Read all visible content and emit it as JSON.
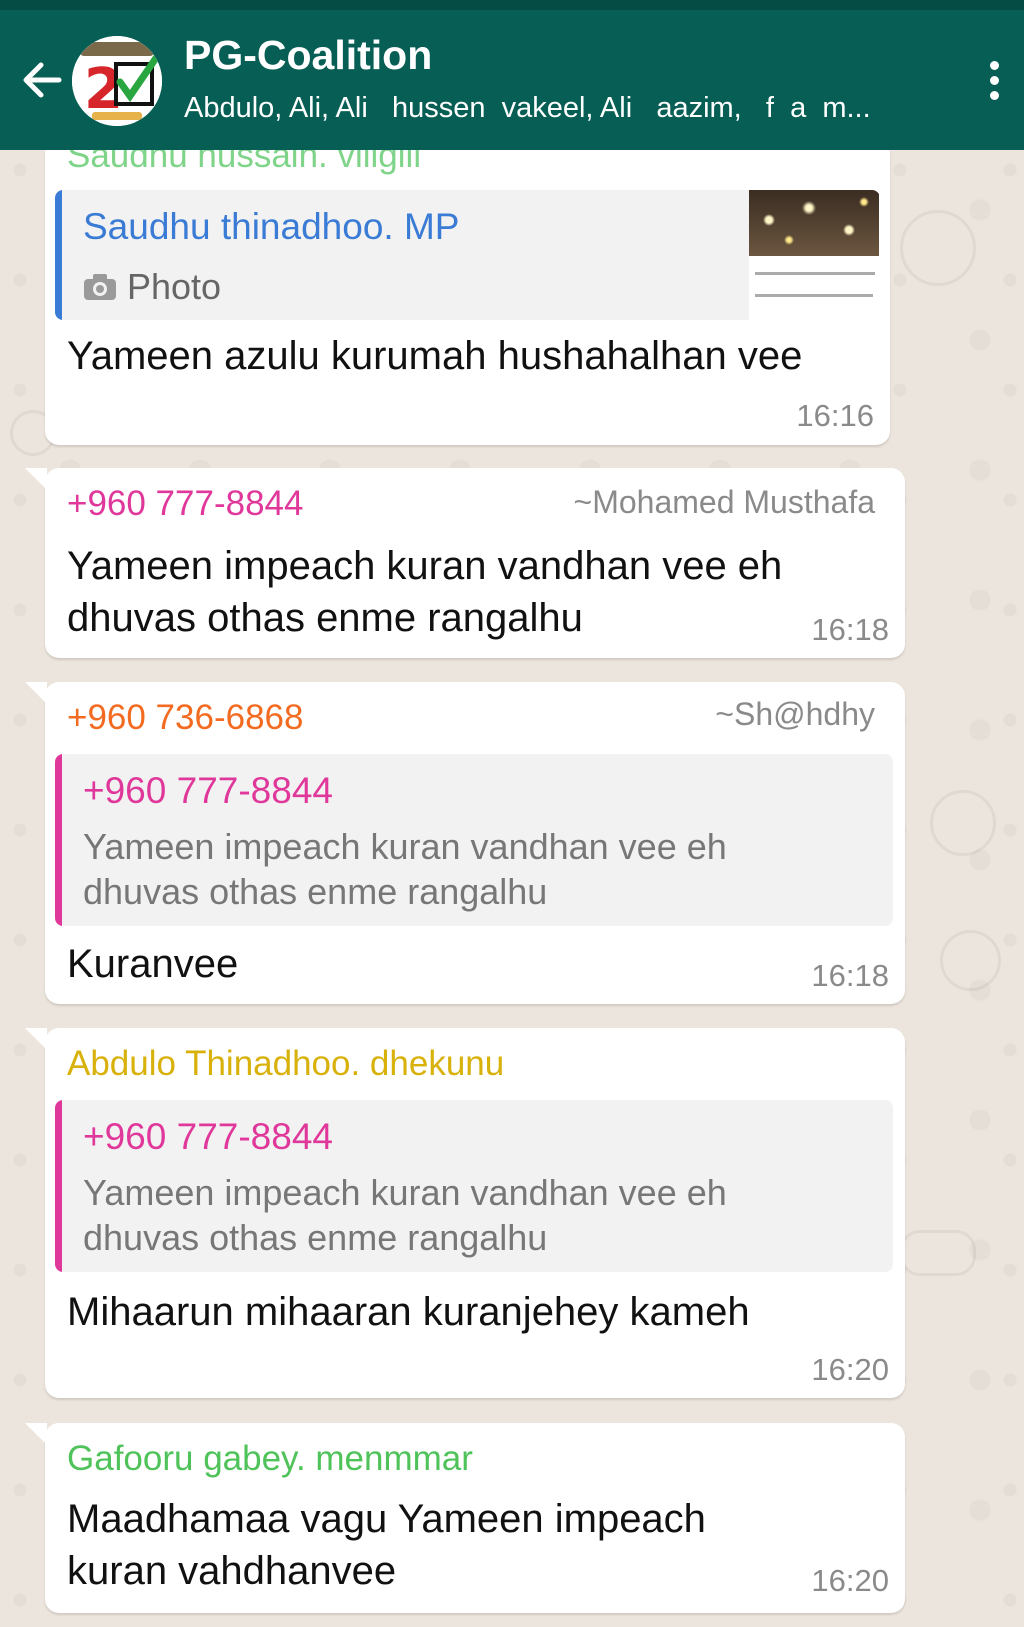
{
  "header": {
    "title": "PG-Coalition",
    "members": "Abdulo, Ali, Ali   hussen  vakeel, Ali   aazim,   f  a  m..."
  },
  "top_partial": {
    "sender": "Saudhu hussain. viligili"
  },
  "messages": [
    {
      "quote_sender": "Saudhu thinadhoo. MP",
      "quote_type": "Photo",
      "text": "Yameen azulu kurumah hushahalhan vee",
      "time": "16:16"
    },
    {
      "sender": "+960 777-8844",
      "alias": "~Mohamed Musthafa",
      "text_line1": "Yameen impeach kuran vandhan vee eh",
      "text_line2": "dhuvas othas enme rangalhu",
      "time": "16:18"
    },
    {
      "sender": "+960 736-6868",
      "alias": "~Sh@hdhy",
      "quote_sender": "+960 777-8844",
      "quote_line1": "Yameen impeach kuran vandhan vee eh",
      "quote_line2": "dhuvas othas enme rangalhu",
      "text": "Kuranvee",
      "time": "16:18"
    },
    {
      "sender": "Abdulo Thinadhoo. dhekunu",
      "quote_sender": "+960 777-8844",
      "quote_line1": "Yameen impeach kuran vandhan vee eh",
      "quote_line2": "dhuvas othas enme rangalhu",
      "text": "Mihaarun mihaaran kuranjehey kameh",
      "time": "16:20"
    },
    {
      "sender": "Gafooru gabey. menmmar",
      "text_line1": "Maadhamaa vagu Yameen impeach",
      "text_line2": "kuran vahdhanvee",
      "time": "16:20"
    }
  ],
  "colors": {
    "header_bg": "#075e54",
    "blue": "#3a7bd5",
    "pink": "#e0389a",
    "orange": "#f36b21",
    "yellow": "#d8b10a",
    "green": "#4fc35a"
  }
}
